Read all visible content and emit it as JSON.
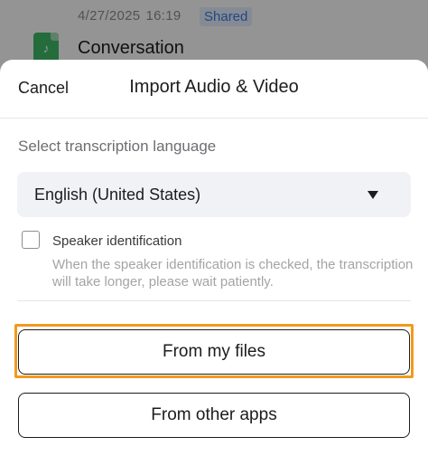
{
  "background": {
    "item_date": "4/27/2025",
    "item_time": "16:19",
    "item_badge": "Shared",
    "item_title": "Conversation",
    "item_icon": "music-file-icon"
  },
  "sheet": {
    "cancel_label": "Cancel",
    "title": "Import Audio & Video",
    "language_label": "Select transcription language",
    "language_selected": "English (United States)",
    "speaker_label": "Speaker identification",
    "speaker_checked": false,
    "speaker_hint": "When the speaker identification is checked, the transcription will take longer, please wait patiently.",
    "from_files_label": "From my files",
    "from_apps_label": "From other apps"
  },
  "colors": {
    "highlight": "#f29a1d",
    "badge_text": "#3d7be0",
    "file_icon": "#3fba68"
  }
}
